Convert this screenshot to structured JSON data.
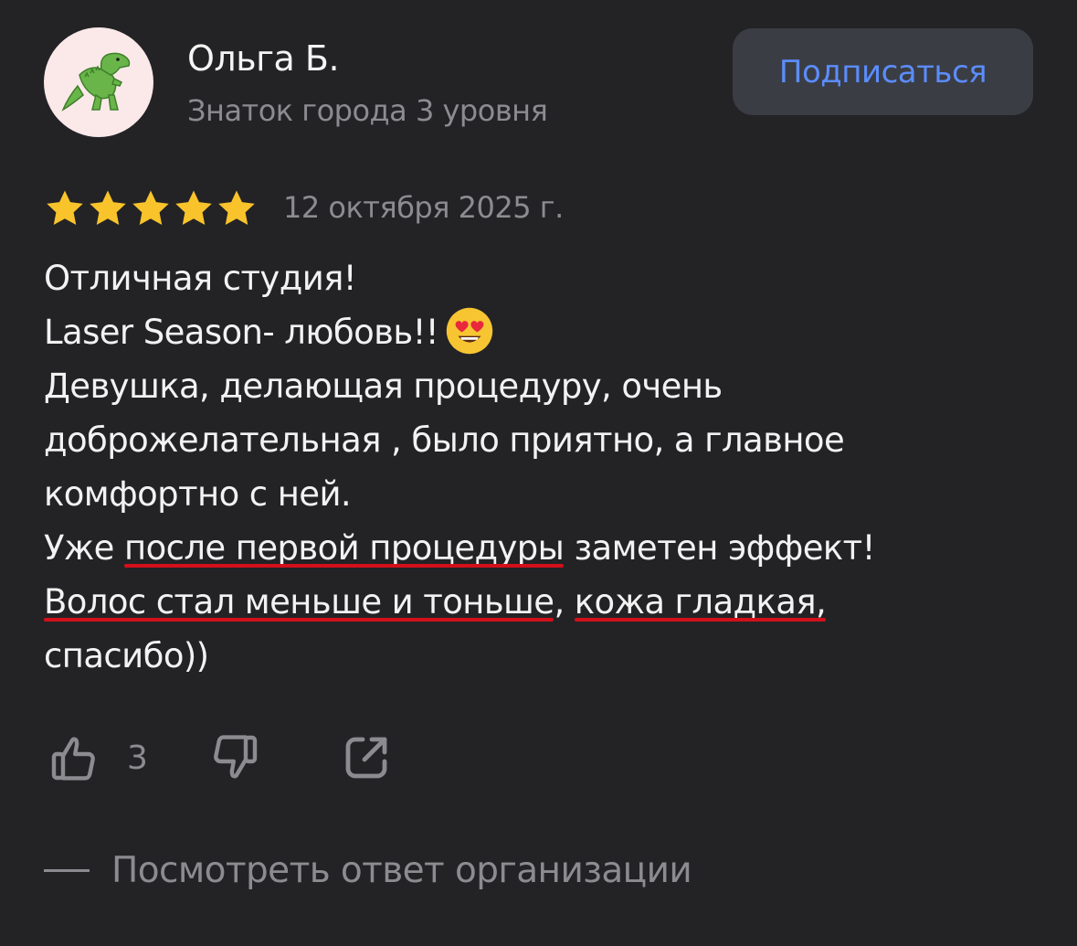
{
  "author": {
    "name": "Ольга Б.",
    "level": "Знаток города 3 уровня",
    "avatar_icon": "dinosaur-icon"
  },
  "subscribe_label": "Подписаться",
  "rating": {
    "stars": 5,
    "max": 5,
    "date": "12 октября 2025 г."
  },
  "review": {
    "l1": "Отличная студия!",
    "l2": "Laser Season- любовь!!",
    "l3": "Девушка, делающая процедуру, очень",
    "l4": "доброжелательная , было приятно, а главное",
    "l5": "комфортно с ней.",
    "l6a": "Уже ",
    "l6b": "после первой процедуры",
    "l6c": " заметен эффект!",
    "l7a": "Волос стал меньше и тоньше",
    "l7b": ", ",
    "l7c": "кожа гладкая,",
    "l8": "спасибо))"
  },
  "actions": {
    "like_count": "3",
    "like_icon": "thumbs-up-icon",
    "dislike_icon": "thumbs-down-icon",
    "share_icon": "share-icon"
  },
  "org_reply_label": "Посмотреть ответ организации",
  "colors": {
    "background": "#232326",
    "accent": "#5b8dfb",
    "star": "#f9c32b",
    "underline": "#d3101a",
    "muted": "#8c8c90"
  }
}
